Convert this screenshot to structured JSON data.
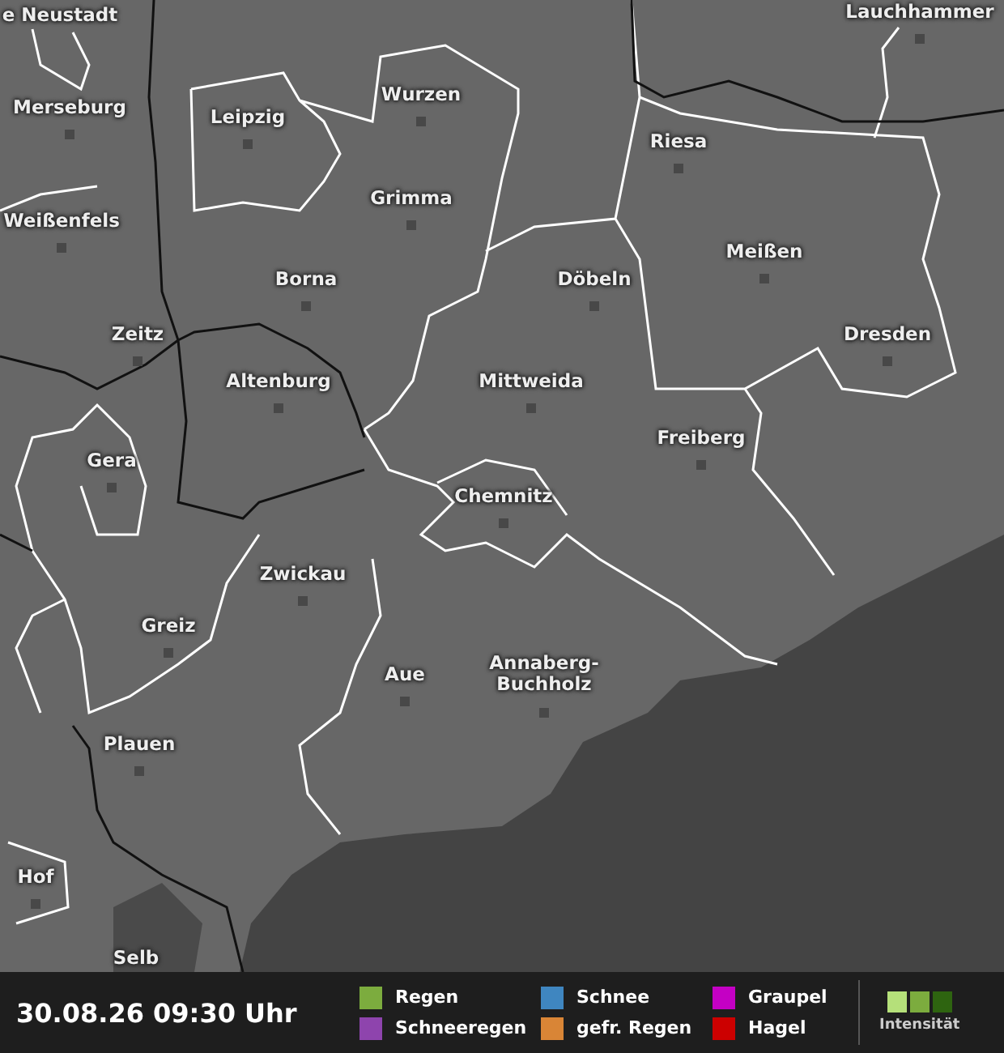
{
  "map": {
    "places": [
      {
        "name": "e Neustadt"
      },
      {
        "name": "Lauchhammer"
      },
      {
        "name": "Merseburg"
      },
      {
        "name": "Leipzig"
      },
      {
        "name": "Wurzen"
      },
      {
        "name": "Riesa"
      },
      {
        "name": "Weißenfels"
      },
      {
        "name": "Grimma"
      },
      {
        "name": "Meißen"
      },
      {
        "name": "Borna"
      },
      {
        "name": "Döbeln"
      },
      {
        "name": "Zeitz"
      },
      {
        "name": "Dresden"
      },
      {
        "name": "Altenburg"
      },
      {
        "name": "Mittweida"
      },
      {
        "name": "Freiberg"
      },
      {
        "name": "Gera"
      },
      {
        "name": "Chemnitz"
      },
      {
        "name": "Zwickau"
      },
      {
        "name": "Greiz"
      },
      {
        "name": "Aue"
      },
      {
        "name": "Annaberg-Buchholz"
      },
      {
        "name": "Plauen"
      },
      {
        "name": "Hof"
      },
      {
        "name": "Selb"
      }
    ]
  },
  "footer": {
    "timestamp": "30.08.26 09:30 Uhr",
    "legend": [
      {
        "label": "Regen",
        "color": "#7cac3e"
      },
      {
        "label": "Schnee",
        "color": "#3f86c0"
      },
      {
        "label": "Graupel",
        "color": "#c400c4"
      },
      {
        "label": "Schneeregen",
        "color": "#8e44ad"
      },
      {
        "label": "gefr. Regen",
        "color": "#d98536"
      },
      {
        "label": "Hagel",
        "color": "#cc0000"
      }
    ],
    "intensity_label": "Intensität"
  }
}
